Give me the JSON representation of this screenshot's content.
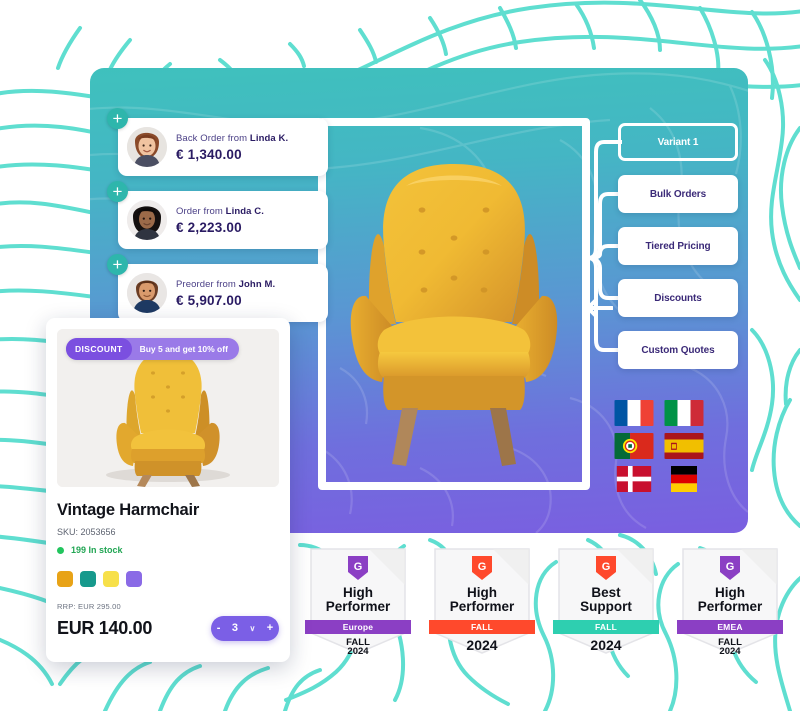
{
  "theme": {
    "topo_line": "#5fded0",
    "panel_gradient_top": "#3fc1bd",
    "panel_gradient_bottom": "#7a5fe0",
    "accent_purple": "#7b5fe6",
    "accent_teal": "#2eb6ac",
    "stock_green": "#22a654"
  },
  "orders": [
    {
      "plus_icon": "plus-icon",
      "avatar": "avatar-linda-k",
      "prefix": "Back Order from ",
      "name": "Linda K.",
      "amount": "€ 1,340.00"
    },
    {
      "plus_icon": "plus-icon",
      "avatar": "avatar-linda-c",
      "prefix": "Order from ",
      "name": "Linda C.",
      "amount": "€ 2,223.00"
    },
    {
      "plus_icon": "plus-icon",
      "avatar": "avatar-john-m",
      "prefix": "Preorder from ",
      "name": "John M.",
      "amount": "€ 5,907.00"
    }
  ],
  "hero": {
    "image_name": "yellow-velvet-armchair",
    "arrow_icon": "arrow-left-icon"
  },
  "variant_tree": {
    "root": "Variant 1",
    "nodes": [
      "Bulk Orders",
      "Tiered Pricing",
      "Discounts",
      "Custom Quotes"
    ]
  },
  "flags": [
    {
      "name": "flag-france",
      "label": "France"
    },
    {
      "name": "flag-italy",
      "label": "Italy"
    },
    {
      "name": "flag-portugal",
      "label": "Portugal"
    },
    {
      "name": "flag-spain",
      "label": "Spain"
    },
    {
      "name": "flag-denmark",
      "label": "Denmark"
    },
    {
      "name": "flag-germany",
      "label": "Germany"
    }
  ],
  "product_card": {
    "image_name": "yellow-armchair-thumbnail",
    "badge_label": "DISCOUNT",
    "badge_text": "Buy 5 and get 10% off",
    "title": "Vintage Harmchair",
    "sku": "SKU: 2053656",
    "stock": "199 In stock",
    "swatches": [
      "#e8a317",
      "#16998c",
      "#f7e04a",
      "#8a6ae6"
    ],
    "rrp": "RRP: EUR 295.00",
    "price": "EUR 140.00",
    "stepper": {
      "minus": "-",
      "value": "3",
      "chevron": "∨",
      "plus": "+"
    }
  },
  "g2_badges": [
    {
      "logo": "g2-logo-icon",
      "logo_color": "#8b3fc4",
      "line1": "High",
      "line2": "Performer",
      "ribbon": "Europe",
      "ribbon_color": "#8b3fc4",
      "fall": "FALL",
      "year": "2024",
      "big_year": false
    },
    {
      "logo": "g2-logo-icon",
      "logo_color": "#ff492c",
      "line1": "High",
      "line2": "Performer",
      "ribbon": "FALL",
      "ribbon_color": "#ff492c",
      "fall": "",
      "year": "2024",
      "big_year": true
    },
    {
      "logo": "g2-logo-icon",
      "logo_color": "#ff492c",
      "line1": "Best",
      "line2": "Support",
      "ribbon": "FALL",
      "ribbon_color": "#2ecfb0",
      "fall": "",
      "year": "2024",
      "big_year": true
    },
    {
      "logo": "g2-logo-icon",
      "logo_color": "#8b3fc4",
      "line1": "High",
      "line2": "Performer",
      "ribbon": "EMEA",
      "ribbon_color": "#8b3fc4",
      "fall": "FALL",
      "year": "2024",
      "big_year": false
    }
  ]
}
